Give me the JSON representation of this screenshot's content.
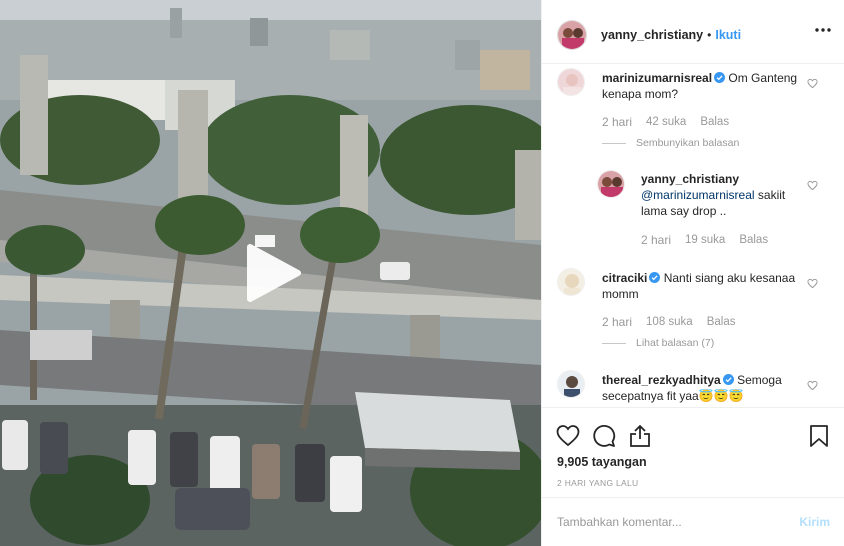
{
  "post": {
    "username": "yanny_christiany",
    "separator": "•",
    "follow_label": "Ikuti",
    "views": "9,905 tayangan",
    "date": "2 HARI YANG LALU"
  },
  "comments": [
    {
      "username": "marinizumarnisreal",
      "text": "Om Ganteng kenapa mom?",
      "time": "2 hari",
      "likes": "42 suka",
      "reply_label": "Balas",
      "thread_label": "Sembunyikan balasan"
    },
    {
      "username": "yanny_christiany",
      "mention": "@marinizumarnisreal",
      "text": "sakiit lama say drop ..",
      "time": "2 hari",
      "likes": "19 suka",
      "reply_label": "Balas"
    },
    {
      "username": "citraciki",
      "text": "Nanti siang aku kesanaa momm",
      "time": "2 hari",
      "likes": "108 suka",
      "reply_label": "Balas",
      "thread_label": "Lihat balasan (7)"
    },
    {
      "username": "thereal_rezkyadhitya",
      "text": "Semoga secepatnya fit yaa😇😇😇"
    }
  ],
  "add_comment": {
    "placeholder": "Tambahkan komentar...",
    "send_label": "Kirim"
  },
  "colors": {
    "accent": "#3897f0",
    "verified": "#3897f0",
    "muted": "#999999"
  },
  "icons": [
    "play-icon",
    "more-options-icon",
    "heart-icon",
    "comment-icon",
    "share-icon",
    "bookmark-icon",
    "verified-badge-icon"
  ]
}
